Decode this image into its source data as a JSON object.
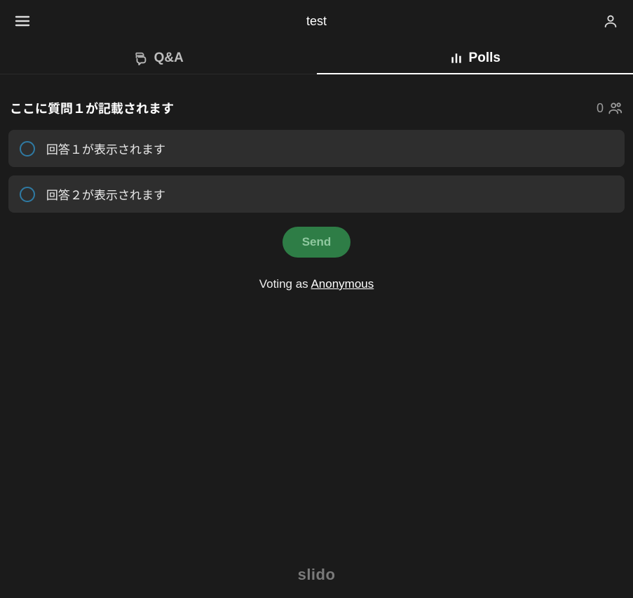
{
  "header": {
    "title": "test"
  },
  "tabs": {
    "qa_label": "Q&A",
    "polls_label": "Polls"
  },
  "poll": {
    "question": "ここに質問１が記載されます",
    "vote_count": "0",
    "options": [
      {
        "label": "回答１が表示されます"
      },
      {
        "label": "回答２が表示されます"
      }
    ],
    "send_label": "Send"
  },
  "voting": {
    "prefix": "Voting as ",
    "name": "Anonymous"
  },
  "footer": {
    "brand": "slido"
  }
}
